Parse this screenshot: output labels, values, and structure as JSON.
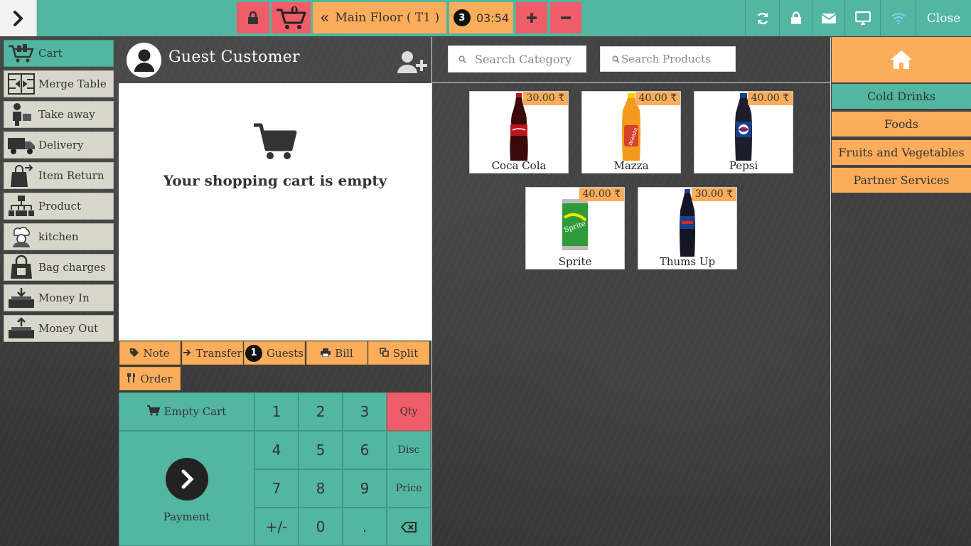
{
  "topbar": {
    "cart_count": "0",
    "table_label": "Main Floor ( T1 )",
    "session_count": "3",
    "timer": "03:54",
    "close_label": "Close"
  },
  "sidebar": {
    "items": [
      {
        "label": "Cart",
        "icon": "cart-icon"
      },
      {
        "label": "Merge Table",
        "icon": "merge-table-icon"
      },
      {
        "label": "Take away",
        "icon": "take-away-icon"
      },
      {
        "label": "Delivery",
        "icon": "delivery-truck-icon"
      },
      {
        "label": "Item Return",
        "icon": "item-return-icon"
      },
      {
        "label": "Product",
        "icon": "product-hierarchy-icon"
      },
      {
        "label": "kitchen",
        "icon": "chef-icon"
      },
      {
        "label": "Bag charges",
        "icon": "bag-icon"
      },
      {
        "label": "Money In",
        "icon": "money-in-icon"
      },
      {
        "label": "Money Out",
        "icon": "money-out-icon"
      }
    ]
  },
  "customer": {
    "name": "Guest Customer"
  },
  "cart": {
    "empty_message": "Your shopping cart is empty"
  },
  "actions": {
    "note": "Note",
    "transfer": "Transfer",
    "guests_count": "1",
    "guests": "Guests",
    "bill": "Bill",
    "split": "Split",
    "order": "Order"
  },
  "keypad": {
    "empty_cart": "Empty Cart",
    "payment": "Payment",
    "keys": [
      "1",
      "2",
      "3",
      "4",
      "5",
      "6",
      "7",
      "8",
      "9",
      "+/-",
      "0",
      "."
    ],
    "qty": "Qty",
    "disc": "Disc",
    "price": "Price"
  },
  "search": {
    "category_placeholder": "Search Category",
    "products_placeholder": "Search Products"
  },
  "products": [
    {
      "name": "Coca Cola",
      "price": "30.00 ₹",
      "color": "#c0141a"
    },
    {
      "name": "Mazza",
      "price": "40.00 ₹",
      "color": "#f39a1e"
    },
    {
      "name": "Pepsi",
      "price": "40.00 ₹",
      "color": "#1b3f8f"
    },
    {
      "name": "Sprite",
      "price": "40.00 ₹",
      "color": "#2e9a3a"
    },
    {
      "name": "Thums Up",
      "price": "30.00 ₹",
      "color": "#1a1a3a"
    }
  ],
  "categories": [
    {
      "label": "Cold Drinks",
      "active": true
    },
    {
      "label": "Foods",
      "active": false
    },
    {
      "label": "Fruits and Vegetables",
      "active": false
    },
    {
      "label": "Partner Services",
      "active": false
    }
  ],
  "colors": {
    "teal": "#52b6a0",
    "orange": "#fbad5b",
    "red": "#ee5d69"
  }
}
